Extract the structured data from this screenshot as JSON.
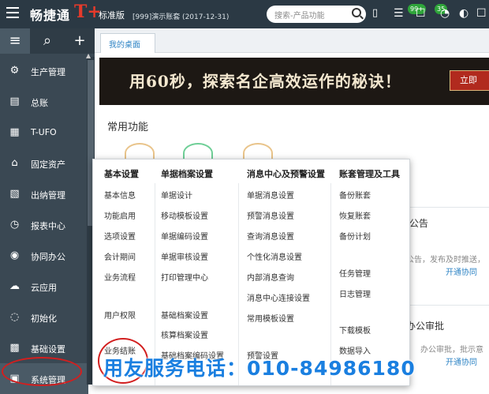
{
  "topbar": {
    "brand": "畅捷通",
    "brand_mark": "T+",
    "edition": "标准版",
    "account": "[999]演示账套  (2017-12-31)",
    "search_placeholder": "搜索-产品功能",
    "badges": [
      "99+",
      "35"
    ]
  },
  "rail": {
    "tools": [
      "menu",
      "search",
      "add"
    ],
    "items": [
      {
        "label": "生产管理",
        "icon": "gears-icon"
      },
      {
        "label": "总账",
        "icon": "ledger-icon"
      },
      {
        "label": "T-UFO",
        "icon": "ufo-icon"
      },
      {
        "label": "固定资产",
        "icon": "asset-icon"
      },
      {
        "label": "出纳管理",
        "icon": "cashier-icon"
      },
      {
        "label": "报表中心",
        "icon": "report-icon"
      },
      {
        "label": "协同办公",
        "icon": "collab-icon"
      },
      {
        "label": "云应用",
        "icon": "cloud-icon"
      },
      {
        "label": "初始化",
        "icon": "init-icon"
      },
      {
        "label": "基础设置",
        "icon": "settings-icon"
      },
      {
        "label": "系统管理",
        "icon": "system-icon"
      }
    ]
  },
  "tabs": [
    {
      "label": "我的桌面"
    }
  ],
  "banner": {
    "text": "用60秒，探索名企高效运作的秘诀！",
    "button": "立即"
  },
  "desk": {
    "section_title": "常用功能"
  },
  "right_panel": {
    "heading1": "公告",
    "text1": "公告，发布及时推送，",
    "link1": "开通协同",
    "heading2": "办公审批",
    "text2": "办公审批，批示意",
    "link2": "开通协同"
  },
  "dropdown": {
    "columns": [
      {
        "title": "基本设置",
        "items": [
          "基本信息",
          "功能启用",
          "选项设置",
          "会计期间",
          "业务流程",
          "用户权限",
          "业务结账"
        ]
      },
      {
        "title": "单据档案设置",
        "items": [
          "单据设计",
          "移动模板设置",
          "单据编码设置",
          "单据审核设置",
          "打印管理中心",
          "基础档案设置",
          "核算档案设置",
          "基础档案编码设置"
        ]
      },
      {
        "title": "消息中心及预警设置",
        "items": [
          "单据消息设置",
          "预警消息设置",
          "查询消息设置",
          "个性化消息设置",
          "内部消息查询",
          "消息中心连接设置",
          "常用模板设置",
          "预警设置"
        ]
      },
      {
        "title": "账套管理及工具",
        "items": [
          "备份账套",
          "恢复账套",
          "备份计划",
          "任务管理",
          "日志管理",
          "下载模板",
          "数据导入"
        ]
      }
    ]
  },
  "hotline": "用友服务电话：010-84986180",
  "colors": {
    "topbar": "#2b3944",
    "rail": "#3a4853",
    "accent": "#2f84c5",
    "highlight": "#d21f1f"
  }
}
